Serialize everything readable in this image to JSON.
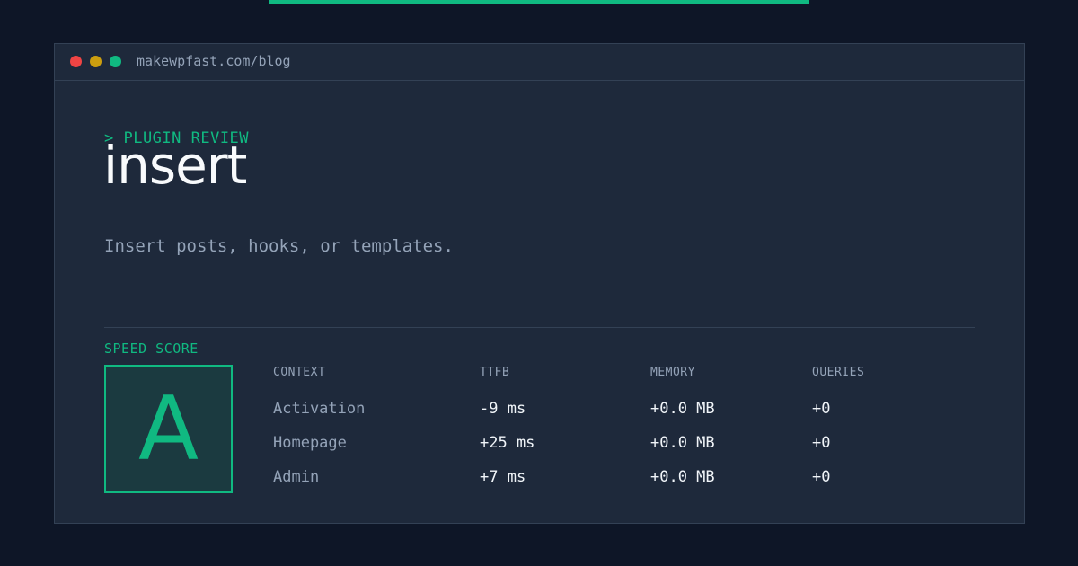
{
  "window": {
    "url": "makewpfast.com/blog"
  },
  "hero": {
    "eyebrow": "> PLUGIN REVIEW",
    "title": "insert",
    "subtitle": "Insert posts, hooks, or templates."
  },
  "speed": {
    "label": "SPEED SCORE",
    "grade": "A"
  },
  "metrics": {
    "headers": [
      "CONTEXT",
      "TTFB",
      "MEMORY",
      "QUERIES"
    ],
    "rows": [
      [
        "Activation",
        "-9 ms",
        "+0.0 MB",
        "+0"
      ],
      [
        "Homepage",
        "+25 ms",
        "+0.0 MB",
        "+0"
      ],
      [
        "Admin",
        "+7 ms",
        "+0.0 MB",
        "+0"
      ]
    ]
  },
  "colors": {
    "accent": "#10b981",
    "background": "#0e1627",
    "panel": "#1e293b"
  }
}
